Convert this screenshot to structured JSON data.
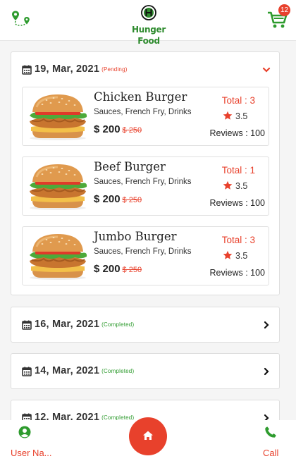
{
  "app": {
    "brand": "Hunger Food",
    "cart_count": "12",
    "accent_color": "#e8412c",
    "brand_color": "#2e8b2e"
  },
  "orders": [
    {
      "date": "19, Mar, 2021",
      "status": "(Pending)",
      "expanded": true,
      "items": [
        {
          "name": "Chicken Burger",
          "desc": "Sauces, French Fry, Drinks",
          "price": "$ 200",
          "old_price": "$ 250",
          "total": "Total : 3",
          "rating": "3.5",
          "reviews": "Reviews : 100"
        },
        {
          "name": "Beef Burger",
          "desc": "Sauces, French Fry, Drinks",
          "price": "$ 200",
          "old_price": "$ 250",
          "total": "Total : 1",
          "rating": "3.5",
          "reviews": "Reviews : 100"
        },
        {
          "name": "Jumbo Burger",
          "desc": "Sauces, French Fry, Drinks",
          "price": "$ 200",
          "old_price": "$ 250",
          "total": "Total : 3",
          "rating": "3.5",
          "reviews": "Reviews : 100"
        }
      ]
    },
    {
      "date": "16, Mar, 2021",
      "status": "(Completed)",
      "expanded": false
    },
    {
      "date": "14, Mar, 2021",
      "status": "(Completed)",
      "expanded": false
    },
    {
      "date": "12, Mar, 2021",
      "status": "(Completed)",
      "expanded": false
    }
  ],
  "footer": {
    "user_label": "User Na...",
    "call_label": "Call",
    "icons": [
      "user-circle-icon",
      "home-icon",
      "phone-icon"
    ]
  }
}
